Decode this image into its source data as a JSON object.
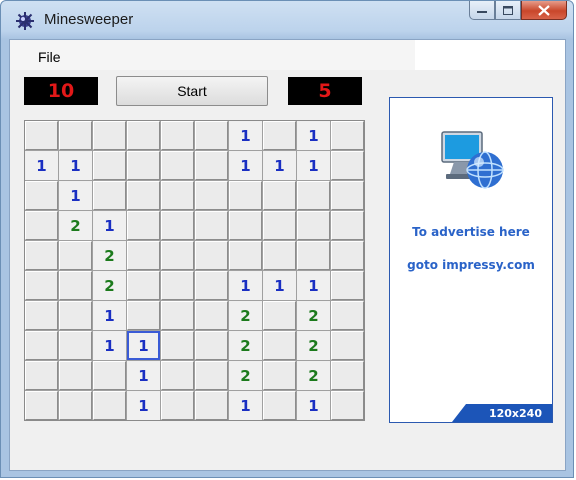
{
  "window": {
    "title": "Minesweeper"
  },
  "menu": {
    "file_label": "File"
  },
  "toolbar": {
    "left_counter": "10",
    "start_label": "Start",
    "right_counter": "5"
  },
  "board": {
    "rows": [
      [
        "c",
        "c",
        "c",
        "c",
        "c",
        "c",
        "1",
        "c",
        "1",
        "c"
      ],
      [
        "1",
        "1",
        "c",
        "c",
        "c",
        "c",
        "1",
        "1",
        "1",
        "c"
      ],
      [
        "c",
        "1",
        "c",
        "c",
        "c",
        "c",
        "c",
        "c",
        "c",
        "c"
      ],
      [
        "c",
        "2",
        "1",
        "c",
        "c",
        "c",
        "c",
        "c",
        "c",
        "c"
      ],
      [
        "c",
        "c",
        "2",
        "c",
        "c",
        "c",
        "c",
        "c",
        "c",
        "c"
      ],
      [
        "c",
        "c",
        "2",
        "c",
        "c",
        "c",
        "1",
        "1",
        "1",
        "c"
      ],
      [
        "c",
        "c",
        "1",
        "c",
        "c",
        "c",
        "2",
        "c",
        "2",
        "c"
      ],
      [
        "c",
        "c",
        "1",
        "1",
        "c",
        "c",
        "2",
        "c",
        "2",
        "c"
      ],
      [
        "c",
        "c",
        "c",
        "1",
        "c",
        "c",
        "2",
        "c",
        "2",
        "c"
      ],
      [
        "c",
        "c",
        "c",
        "1",
        "c",
        "c",
        "1",
        "c",
        "1",
        "c"
      ]
    ],
    "focused_cell": [
      7,
      3
    ]
  },
  "ad": {
    "line1": "To advertise here",
    "line2": "goto impressy.com",
    "size_label": "120x240",
    "icon": "computer-globe-icon"
  },
  "colors": {
    "number_1": "#1a2fc2",
    "number_2": "#1c7a1c",
    "counter_text": "#e21818",
    "ad_text": "#2a63c8"
  }
}
